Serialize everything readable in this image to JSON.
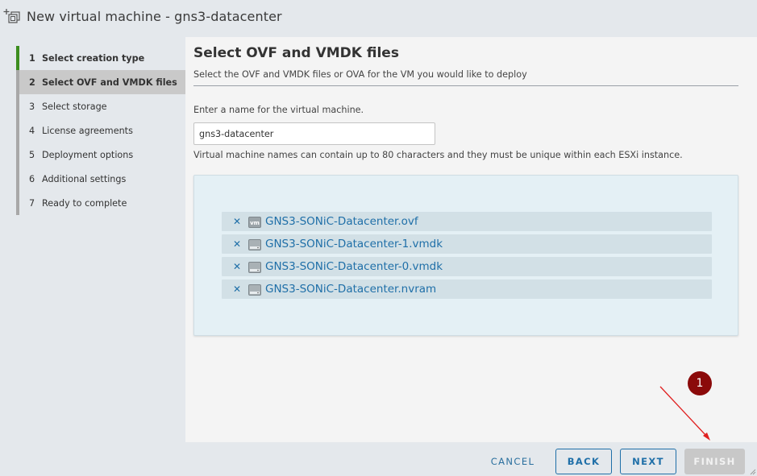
{
  "window": {
    "title": "New virtual machine - gns3-datacenter",
    "icon": "new-vm-icon"
  },
  "sidebar": {
    "steps": [
      {
        "num": "1",
        "label": "Select creation type",
        "state": "done"
      },
      {
        "num": "2",
        "label": "Select OVF and VMDK files",
        "state": "active"
      },
      {
        "num": "3",
        "label": "Select storage",
        "state": "pending"
      },
      {
        "num": "4",
        "label": "License agreements",
        "state": "pending"
      },
      {
        "num": "5",
        "label": "Deployment options",
        "state": "pending"
      },
      {
        "num": "6",
        "label": "Additional settings",
        "state": "pending"
      },
      {
        "num": "7",
        "label": "Ready to complete",
        "state": "pending"
      }
    ]
  },
  "main": {
    "title": "Select OVF and VMDK files",
    "subtitle": "Select the OVF and VMDK files or OVA for the VM you would like to deploy",
    "name_label": "Enter a name for the virtual machine.",
    "name_value": "gns3-datacenter",
    "name_hint": "Virtual machine names can contain up to 80 characters and they must be unique within each ESXi instance.",
    "files": [
      {
        "name": "GNS3-SONiC-Datacenter.ovf",
        "icon": "vm-file-icon"
      },
      {
        "name": "GNS3-SONiC-Datacenter-1.vmdk",
        "icon": "disk-file-icon"
      },
      {
        "name": "GNS3-SONiC-Datacenter-0.vmdk",
        "icon": "disk-file-icon"
      },
      {
        "name": "GNS3-SONiC-Datacenter.nvram",
        "icon": "disk-file-icon"
      }
    ]
  },
  "footer": {
    "cancel": "CANCEL",
    "back": "BACK",
    "next": "NEXT",
    "finish": "FINISH"
  },
  "annotation": {
    "badge": "1",
    "color": "#8b0a0a",
    "arrow_color": "#e02020"
  },
  "colors": {
    "accent": "#1f6fa8",
    "step_done": "#3c8d1e",
    "active_step_bg": "#c9c9c9",
    "dropzone_bg": "#e4f0f5"
  }
}
